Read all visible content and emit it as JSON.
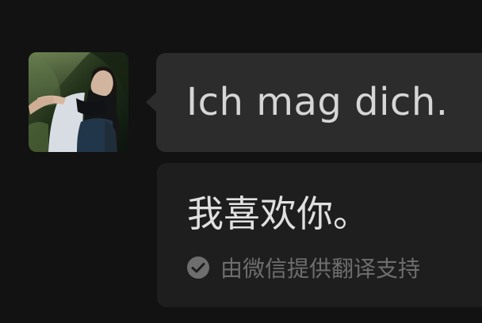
{
  "chat": {
    "avatar_icon": "user-photo-avatar",
    "message": {
      "text": "Ich mag dich."
    },
    "translation": {
      "text": "我喜欢你。",
      "attribution": "由微信提供翻译支持",
      "status_icon": "check-circle-icon"
    }
  },
  "colors": {
    "background": "#121212",
    "bubble": "#2c2c2c",
    "translation_card": "#1e1e1e",
    "message_text": "#d6d6d6",
    "translation_text": "#e0e0e0",
    "muted_text": "#6e6e6e"
  }
}
